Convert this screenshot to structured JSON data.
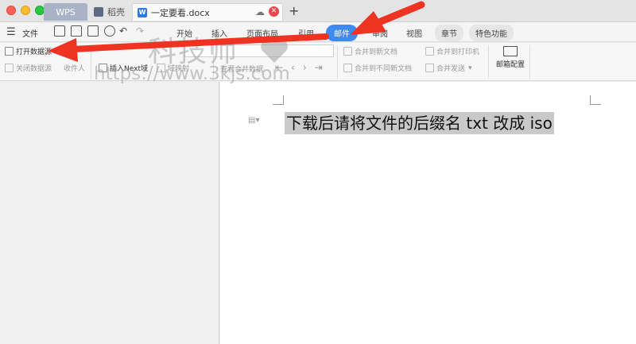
{
  "tabs": {
    "wps": "WPS",
    "daoke": "稻壳",
    "doc": "一定要看.docx"
  },
  "menubar": {
    "file": "文件",
    "items": [
      "开始",
      "插入",
      "页面布局",
      "引用",
      "邮件",
      "审阅",
      "视图",
      "章节",
      "特色功能"
    ]
  },
  "ribbon": {
    "open_source": "打开数据源",
    "close_source": "关闭数据源",
    "recipient": "收件人",
    "insert_next": "插入Next域",
    "field_map": "域映射",
    "view_merge": "查看合并数据",
    "merge_new_doc": "合并到新文档",
    "merge_diff_doc": "合并到不同新文档",
    "merge_printer": "合并到打印机",
    "merge_send": "合并发送",
    "mail_config": "邮箱配置"
  },
  "document": {
    "text": "下载后请将文件的后缀名 txt 改成 iso"
  },
  "watermark": {
    "line1": "科技师",
    "line2": "https://www.3kjs.com"
  },
  "colors": {
    "accent": "#3d8bf2",
    "arrow": "#ee3322"
  },
  "icons": [
    "hamburger-icon",
    "cloud-icon",
    "close-icon",
    "plus-icon",
    "envelope-icon"
  ]
}
